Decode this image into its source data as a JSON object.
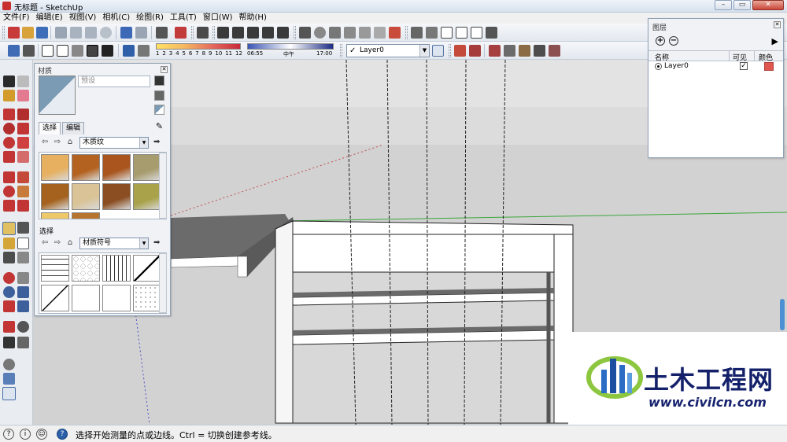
{
  "window": {
    "title": "无标题 - SketchUp",
    "buttons": {
      "minimize": "–",
      "maximize": "▭",
      "close": "✕"
    }
  },
  "menu": [
    "文件(F)",
    "编辑(E)",
    "视图(V)",
    "相机(C)",
    "绘图(R)",
    "工具(T)",
    "窗口(W)",
    "帮助(H)"
  ],
  "toolbar": {
    "shadow_scale": [
      "1",
      "2",
      "3",
      "4",
      "5",
      "6",
      "7",
      "8",
      "9",
      "10",
      "11",
      "12"
    ],
    "time_start": "06:55",
    "time_mid": "中午",
    "time_end": "17:00",
    "layer": "Layer0",
    "colors": {
      "shadow_bar_start": "#ffe066",
      "shadow_bar_end": "#c82a3b"
    }
  },
  "materials": {
    "title": "材质",
    "name_placeholder": "预设",
    "tabs": {
      "select": "选择",
      "edit": "编辑"
    },
    "library": "木质纹",
    "section2_label": "选择",
    "library2": "材质符号",
    "wood_swatches": [
      "#e6b060",
      "#b3621f",
      "#a9551d",
      "#a79c6d",
      "#a4621e",
      "#d9c397",
      "#8a4e22",
      "#a9a24a",
      "#eec96a",
      "#b7742e"
    ],
    "pattern_swatches": [
      "bricks",
      "stones",
      "lines",
      "diagonal-dots",
      "diagonal",
      "white",
      "white",
      "speckle"
    ]
  },
  "layers": {
    "title": "图层",
    "columns": {
      "name": "名称",
      "visible": "可见",
      "color": "颜色"
    },
    "rows": [
      {
        "name": "Layer0",
        "visible": "✓",
        "color": "#e0574f"
      }
    ],
    "add": "+",
    "remove": "−",
    "details": "▶"
  },
  "status": {
    "text": "选择开始测量的点或边线。Ctrl = 切换创建参考线。",
    "icons": [
      "?",
      "i",
      "☺",
      "?"
    ]
  },
  "watermark": {
    "cn": "土木工程网",
    "url": "www.civilcn.com"
  }
}
